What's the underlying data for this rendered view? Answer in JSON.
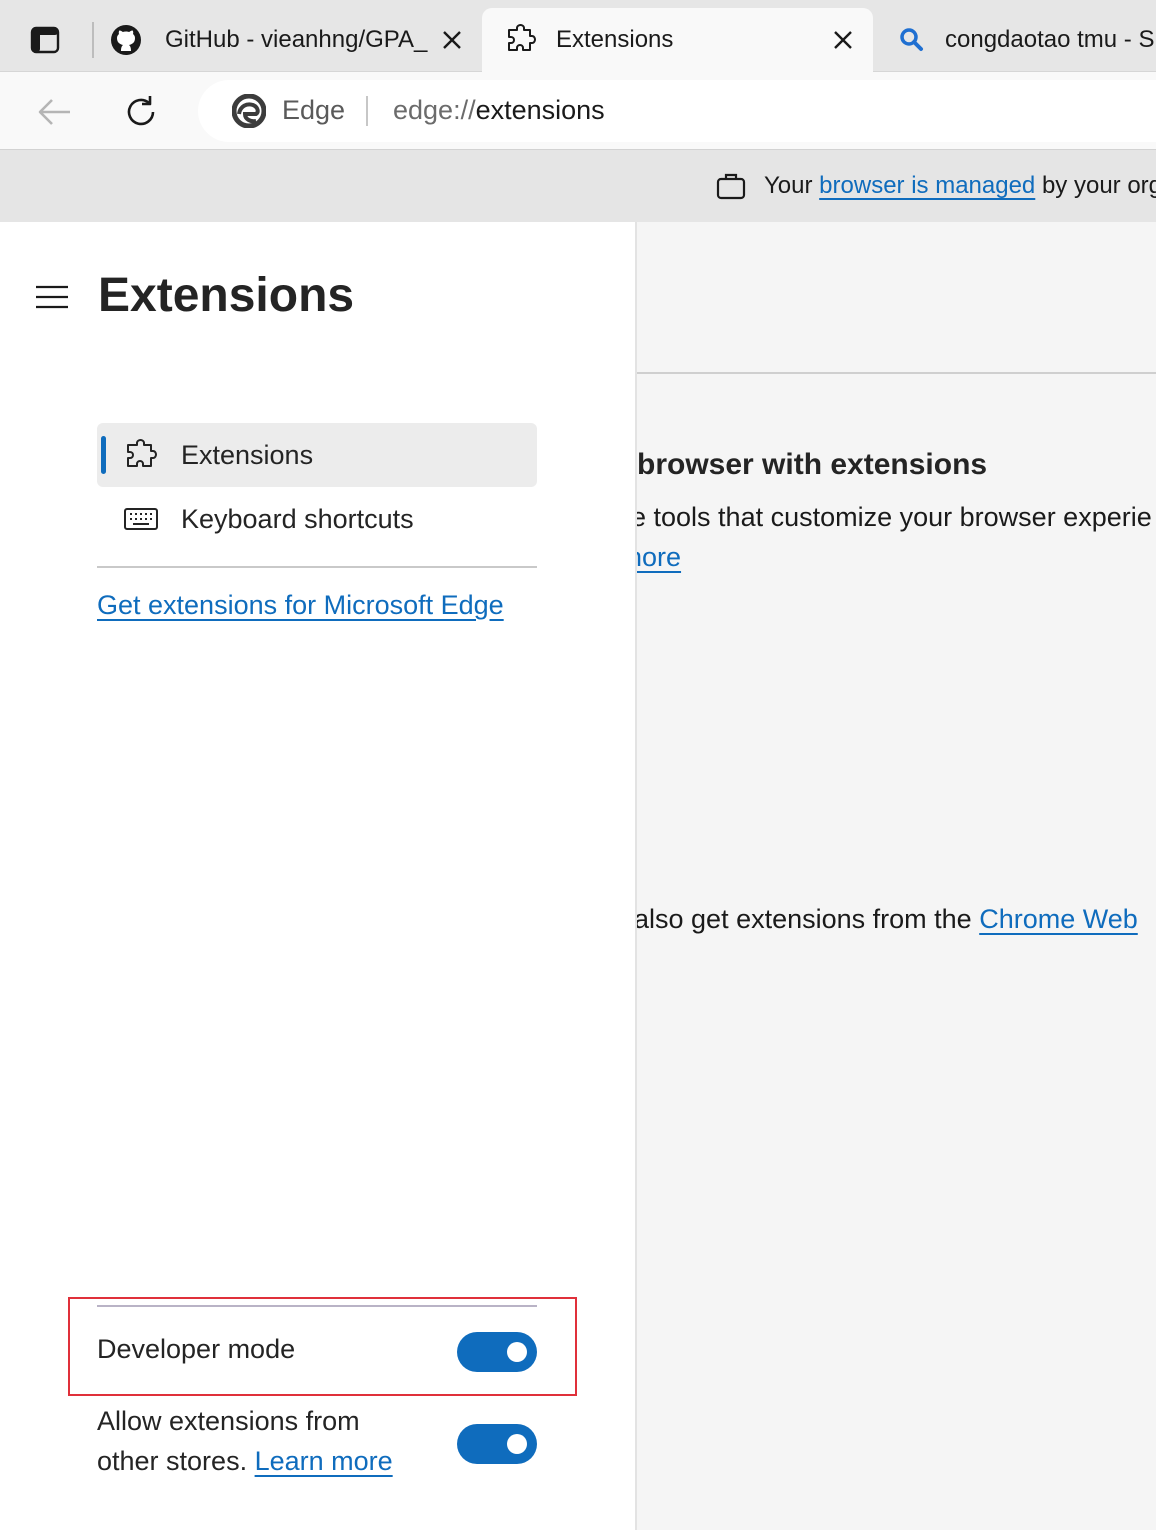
{
  "tabs": [
    {
      "title": "GitHub - vieanhng/GPA_",
      "icon": "github-icon",
      "active": false
    },
    {
      "title": "Extensions",
      "icon": "puzzle-icon",
      "active": true
    },
    {
      "title": "congdaotao tmu - S",
      "icon": "search-icon",
      "active": false
    }
  ],
  "addressbar": {
    "site_label": "Edge",
    "url_scheme": "edge://",
    "url_path": "extensions"
  },
  "infobar": {
    "prefix": "Your",
    "link": "browser is managed",
    "suffix": "by your org"
  },
  "sidebar": {
    "title": "Extensions",
    "nav": [
      {
        "label": "Extensions",
        "icon": "puzzle-icon",
        "selected": true
      },
      {
        "label": "Keyboard shortcuts",
        "icon": "keyboard-icon",
        "selected": false
      }
    ],
    "get_extensions_link": "Get extensions for Microsoft Edge",
    "developer_mode": {
      "label": "Developer mode",
      "enabled": true
    },
    "other_stores": {
      "label_line1": "Allow extensions from",
      "label_line2": "other stores.",
      "learn_more": "Learn more",
      "enabled": true
    }
  },
  "main": {
    "heading": "browser with extensions",
    "description": "e tools that customize your browser experie",
    "learn_more_fragment": "nore",
    "chrome_prefix": "also get extensions from the",
    "chrome_link": "Chrome Web"
  },
  "colors": {
    "accent": "#0f6cbd",
    "highlight_box": "#e0303a"
  }
}
